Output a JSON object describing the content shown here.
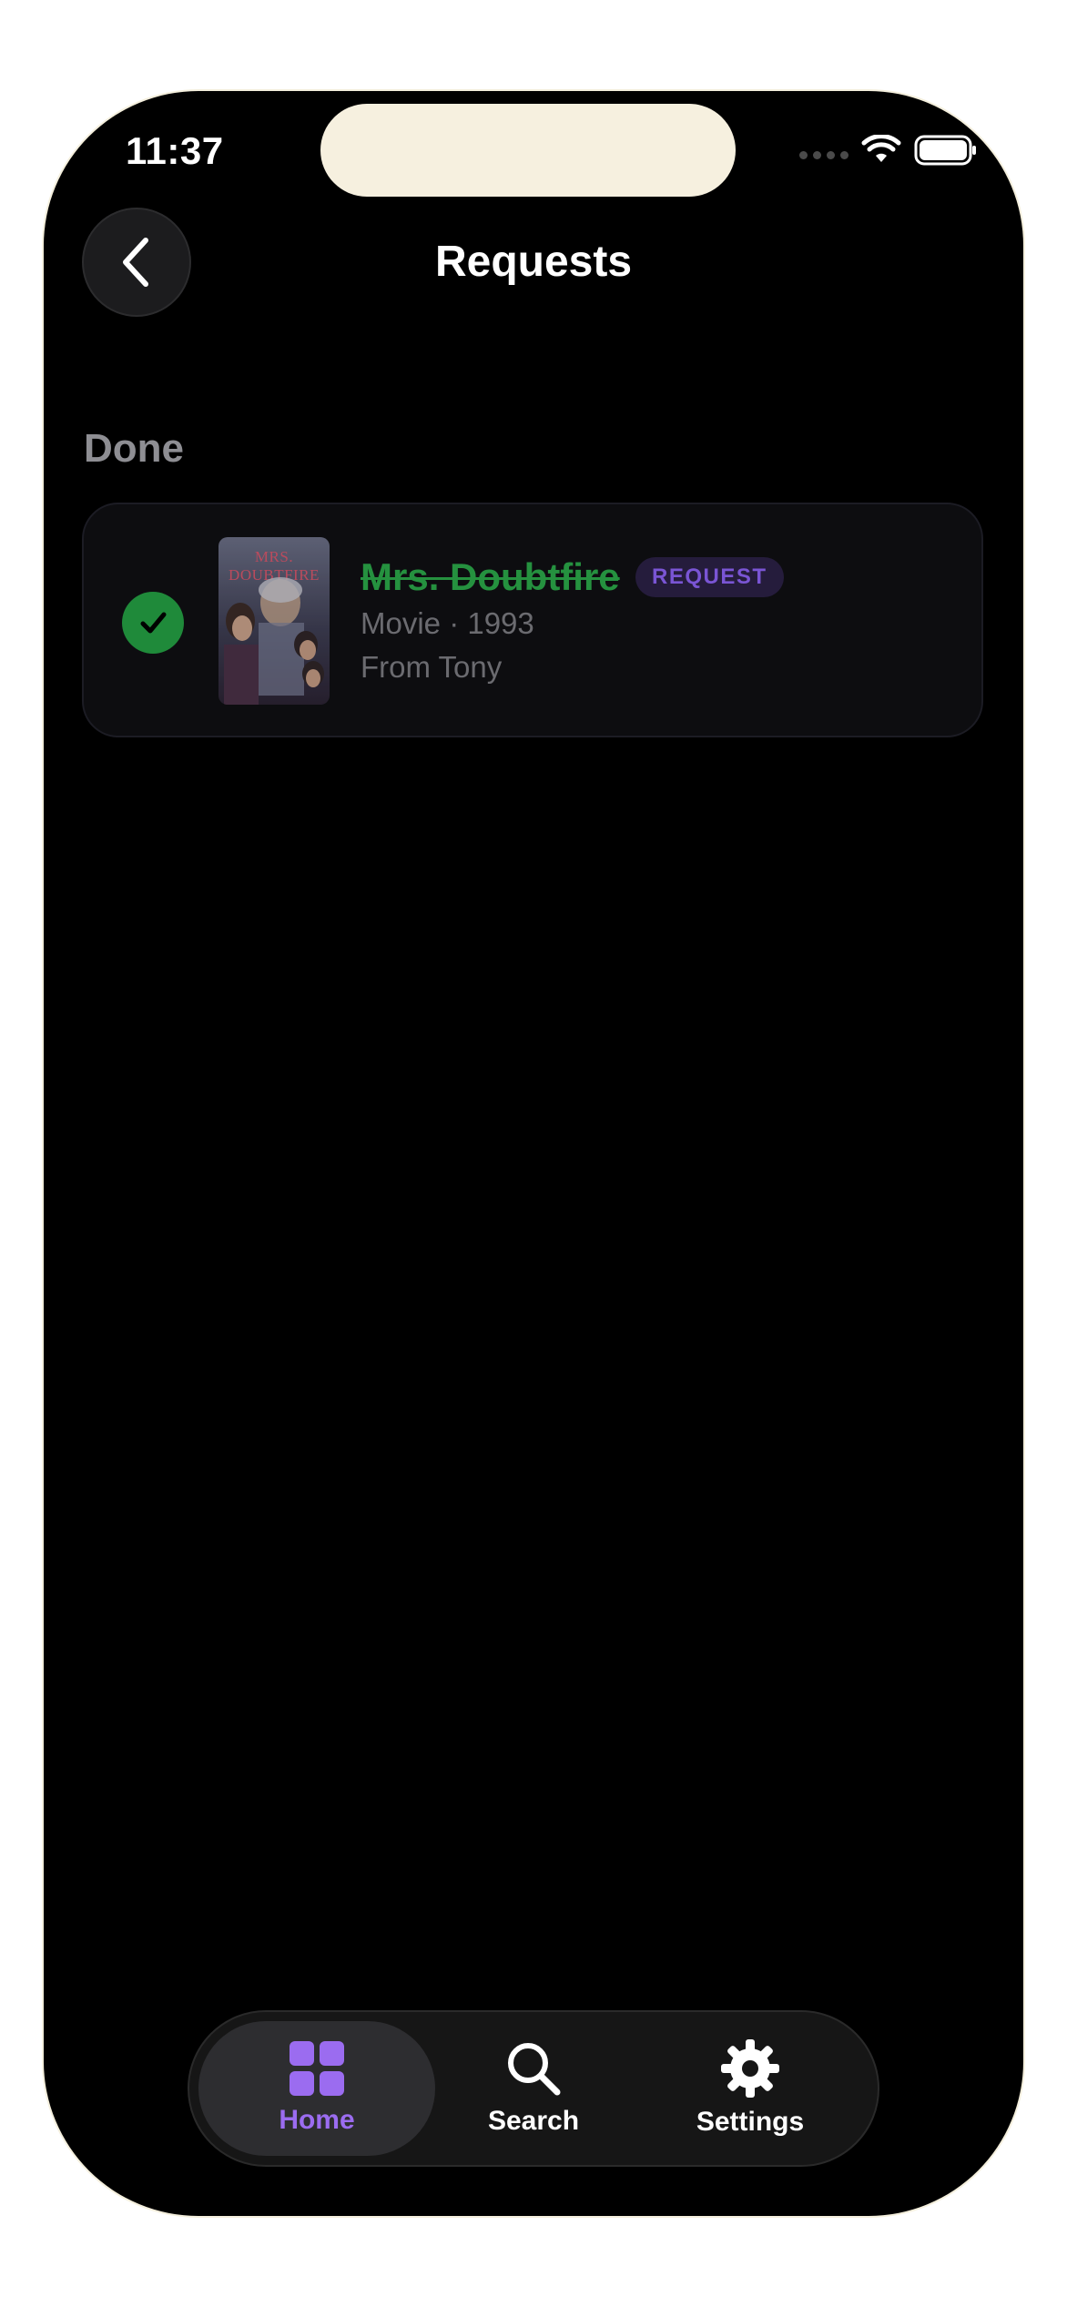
{
  "status_bar": {
    "time": "11:37"
  },
  "header": {
    "title": "Requests",
    "back_icon": "chevron-left-icon"
  },
  "section": {
    "label": "Done"
  },
  "requests": [
    {
      "status_icon": "checkmark-icon",
      "poster_text": "MRS. DOUBTFIRE",
      "title": "Mrs. Doubtfire",
      "badge": "REQUEST",
      "type_year": "Movie · 1993",
      "from": "From Tony"
    }
  ],
  "tabbar": {
    "tabs": [
      {
        "label": "Home",
        "icon": "grid-icon",
        "active": true
      },
      {
        "label": "Search",
        "icon": "search-icon",
        "active": false
      },
      {
        "label": "Settings",
        "icon": "gear-icon",
        "active": false
      }
    ]
  },
  "colors": {
    "accent": "#9b6cf0",
    "done_green": "#1f8a3a",
    "background": "#000000"
  }
}
